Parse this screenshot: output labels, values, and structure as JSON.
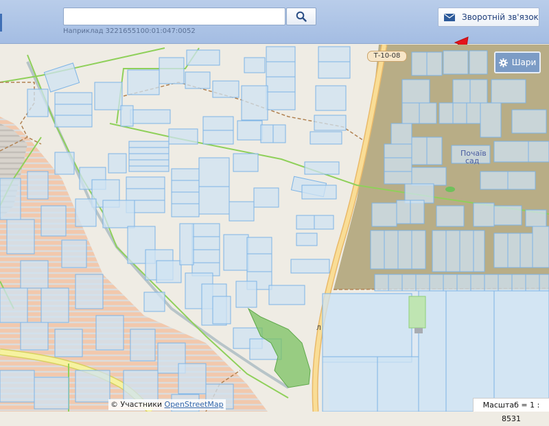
{
  "search": {
    "value": "",
    "placeholder": "",
    "hint": "Наприклад 3221655100:01:047:0052"
  },
  "header": {
    "feedback_label": "Зворотній зв'язок"
  },
  "layers": {
    "label": "Шари"
  },
  "map": {
    "road_label": "Т-10-08",
    "place_label_1": "Почаїв",
    "place_label_2": "сад",
    "street_letter": "Л",
    "colors": {
      "background": "#efece4",
      "parcel_fill": "#cfe3f3",
      "parcel_stroke": "#7db4e6",
      "boundary": "#8fd05a",
      "orchard": "#b9ad87",
      "hatched_zone": "#f1c4a8",
      "road": "#f7d78c"
    }
  },
  "footer": {
    "attribution_prefix": "© Участники",
    "attribution_link": "OpenStreetMap",
    "scale": "Масштаб = 1 : 8531"
  },
  "icons": {
    "search": "search-icon",
    "mail": "mail-icon",
    "gear": "gear-icon",
    "arrow": "red-arrow-icon"
  }
}
